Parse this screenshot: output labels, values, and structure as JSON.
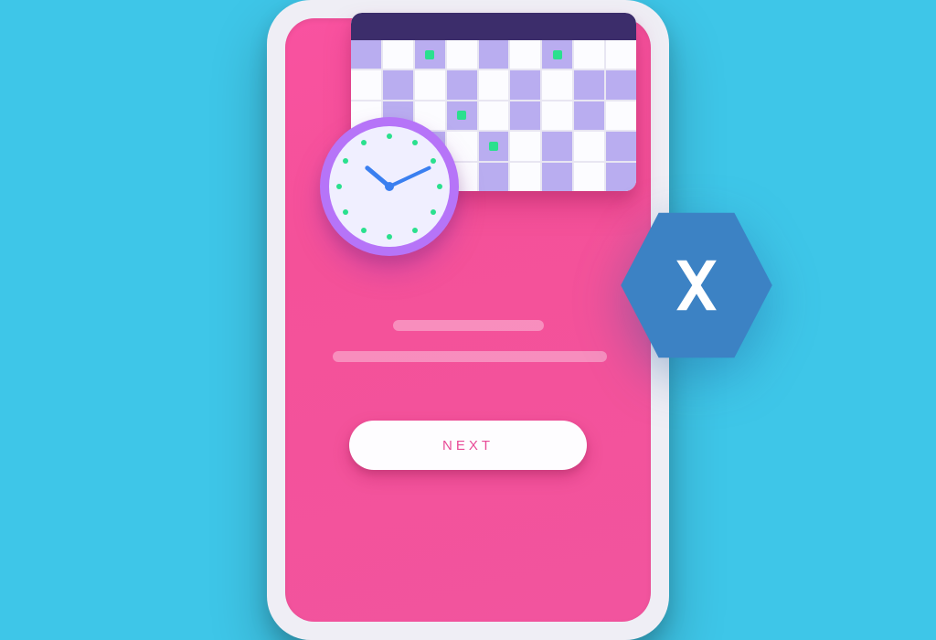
{
  "button": {
    "label": "NEXT"
  },
  "icons": {
    "calendar": "calendar-icon",
    "clock": "clock-icon",
    "xamarin": "xamarin-icon"
  },
  "colors": {
    "background": "#3ec6e8",
    "phone_screen": "#f952a0",
    "accent_green": "#2ae08e",
    "accent_purple": "#b9adf0",
    "clock_ring": "#b674f8",
    "xamarin_blue": "#3c82c4",
    "button_text": "#e84b97"
  },
  "calendar": {
    "cols": 9,
    "rows": 5,
    "alt_cells": [
      0,
      2,
      4,
      6,
      10,
      12,
      14,
      16,
      17,
      19,
      21,
      23,
      25,
      27,
      29,
      31,
      33,
      35,
      36,
      38,
      40,
      42,
      44
    ],
    "dot_cells": [
      2,
      6,
      21,
      29,
      31
    ]
  },
  "clock": {
    "hour_hand_deg": -50,
    "minute_hand_deg": 65,
    "tick_count": 12
  }
}
